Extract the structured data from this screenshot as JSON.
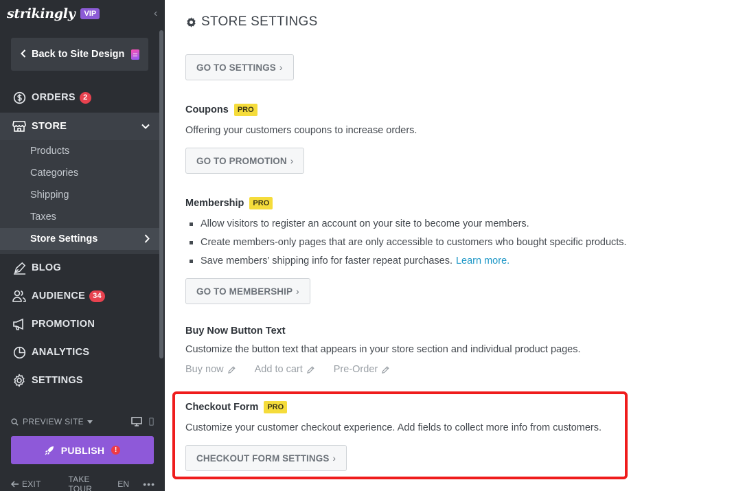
{
  "sidebar": {
    "logo_text": "strikingly",
    "vip_label": "VIP",
    "back_label": "Back to Site Design",
    "nav": {
      "orders": {
        "label": "ORDERS",
        "badge": "2"
      },
      "store": {
        "label": "STORE"
      },
      "blog": {
        "label": "BLOG"
      },
      "audience": {
        "label": "AUDIENCE",
        "badge": "34"
      },
      "promotion": {
        "label": "PROMOTION"
      },
      "analytics": {
        "label": "ANALYTICS"
      },
      "settings": {
        "label": "SETTINGS"
      }
    },
    "store_sub": [
      "Products",
      "Categories",
      "Shipping",
      "Taxes",
      "Store Settings"
    ],
    "preview_label": "PREVIEW SITE",
    "publish_label": "PUBLISH",
    "footer": {
      "exit": "EXIT",
      "tour": "TAKE TOUR",
      "lang": "EN",
      "more": "•••"
    }
  },
  "main": {
    "title": "STORE SETTINGS",
    "go_settings": "GO TO SETTINGS",
    "coupons": {
      "title": "Coupons",
      "badge": "PRO",
      "desc": "Offering your customers coupons to increase orders.",
      "button": "GO TO PROMOTION"
    },
    "membership": {
      "title": "Membership",
      "badge": "PRO",
      "bullets": [
        "Allow visitors to register an account on your site to become your members.",
        "Create members-only pages that are only accessible to customers who bought specific products.",
        "Save members’ shipping info for faster repeat purchases."
      ],
      "learn_more": "Learn more.",
      "button": "GO TO MEMBERSHIP"
    },
    "buy_now": {
      "title": "Buy Now Button Text",
      "desc": "Customize the button text that appears in your store section and individual product pages.",
      "options": [
        "Buy now",
        "Add to cart",
        "Pre-Order"
      ]
    },
    "checkout": {
      "title": "Checkout Form",
      "badge": "PRO",
      "desc": "Customize your customer checkout experience. Add fields to collect more info from customers.",
      "button": "CHECKOUT FORM SETTINGS"
    }
  },
  "colors": {
    "sidebar_bg": "#2b2e33",
    "accent_purple": "#8e59d9",
    "pro_yellow": "#f5dc3b",
    "badge_red": "#e8424f",
    "link_blue": "#1b96c6",
    "highlight_red": "#ef1c1c"
  }
}
